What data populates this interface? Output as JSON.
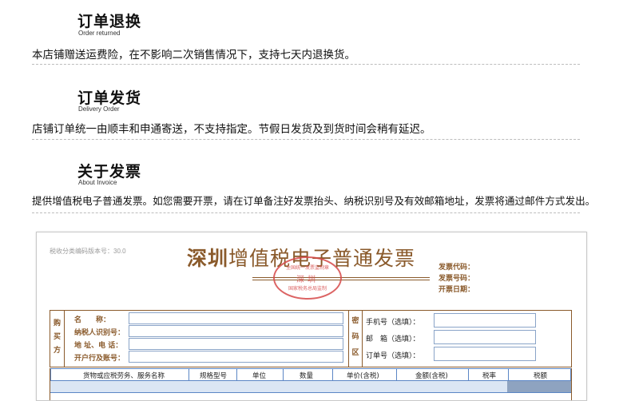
{
  "sections": [
    {
      "title": "订单退换",
      "subtitle": "Order returned",
      "text": "本店铺赠送运费险，在不影响二次销售情况下，支持七天内退换货。"
    },
    {
      "title": "订单发货",
      "subtitle": "Delivery Order",
      "text": "店铺订单统一由顺丰和申通寄送，不支持指定。节假日发货及到货时间会稍有延迟。"
    },
    {
      "title": "关于发票",
      "subtitle": "About Invoice",
      "text": "提供增值税电子普通发票。如您需要开票，请在订单备注好发票抬头、纳税识别号及有效邮箱地址，发票将通过邮件方式发出。"
    }
  ],
  "invoice": {
    "code_label": "税收分类编码版本号：30.0",
    "title_main": "深圳",
    "title_rest": "增值税电子普通发票",
    "seal_top": "全国统一发票监制章",
    "seal_mid": "深圳",
    "seal_bot": "国家税务总局监制",
    "invoice_code_label": "发票代码：",
    "invoice_number_label": "发票号码：",
    "issue_date_label": "开票日期：",
    "buyer_side_label": [
      "购",
      "买",
      "方"
    ],
    "buyer_fields": [
      "名　　称：",
      "纳税人识别号：",
      "地 址、电 话：",
      "开户行及账号："
    ],
    "cipher_label": [
      "密",
      "码",
      "区"
    ],
    "right_fields": [
      "手机号（选填）：",
      "邮　箱（选填）：",
      "订单号（选填）："
    ],
    "table_headers": [
      "货物或应税劳务、服务名称",
      "规格型号",
      "单位",
      "数量",
      "单价(含税)",
      "金额(含税)",
      "税率",
      "税额"
    ]
  }
}
